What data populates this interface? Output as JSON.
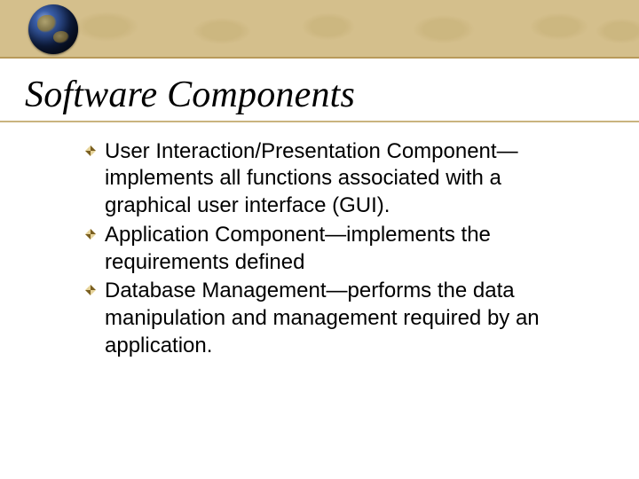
{
  "title": "Software Components",
  "bullets": [
    "User Interaction/Presentation Component—implements all functions associated with a graphical user interface (GUI).",
    "Application Component—implements the requirements defined",
    "Database Management—performs the data manipulation and management required by an application."
  ],
  "colors": {
    "banner_bg": "#d4bf8c",
    "accent_line": "#c9b47f",
    "bullet_dark": "#7a5f20",
    "bullet_light": "#e6d39a"
  }
}
